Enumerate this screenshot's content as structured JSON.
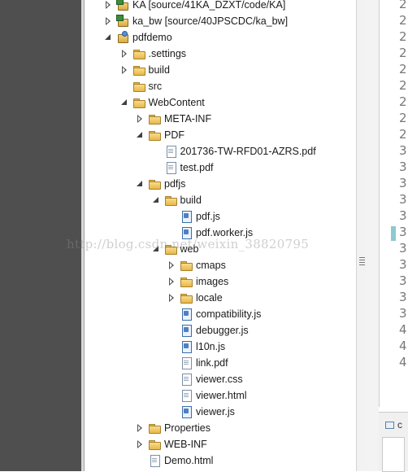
{
  "tree": [
    {
      "label": "KA [source/41KA_DZXT/code/KA]",
      "level": 1,
      "arrow": "collapsed",
      "icon": "projref"
    },
    {
      "label": "ka_bw [source/40JPSCDC/ka_bw]",
      "level": 1,
      "arrow": "collapsed",
      "icon": "projref"
    },
    {
      "label": "pdfdemo",
      "level": 1,
      "arrow": "expanded",
      "icon": "project"
    },
    {
      "label": ".settings",
      "level": 2,
      "arrow": "collapsed",
      "icon": "folder"
    },
    {
      "label": "build",
      "level": 2,
      "arrow": "collapsed",
      "icon": "folder"
    },
    {
      "label": "src",
      "level": 2,
      "arrow": "none",
      "icon": "folder"
    },
    {
      "label": "WebContent",
      "level": 2,
      "arrow": "expanded",
      "icon": "folder"
    },
    {
      "label": "META-INF",
      "level": 3,
      "arrow": "collapsed",
      "icon": "folder"
    },
    {
      "label": "PDF",
      "level": 3,
      "arrow": "expanded",
      "icon": "folder"
    },
    {
      "label": "201736-TW-RFD01-AZRS.pdf",
      "level": 4,
      "arrow": "none",
      "icon": "file"
    },
    {
      "label": "test.pdf",
      "level": 4,
      "arrow": "none",
      "icon": "file"
    },
    {
      "label": "pdfjs",
      "level": 3,
      "arrow": "expanded",
      "icon": "folder"
    },
    {
      "label": "build",
      "level": 4,
      "arrow": "expanded",
      "icon": "folder"
    },
    {
      "label": "pdf.js",
      "level": 5,
      "arrow": "none",
      "icon": "jsfile"
    },
    {
      "label": "pdf.worker.js",
      "level": 5,
      "arrow": "none",
      "icon": "jsfile"
    },
    {
      "label": "web",
      "level": 4,
      "arrow": "expanded",
      "icon": "folder"
    },
    {
      "label": "cmaps",
      "level": 5,
      "arrow": "collapsed",
      "icon": "folder"
    },
    {
      "label": "images",
      "level": 5,
      "arrow": "collapsed",
      "icon": "folder"
    },
    {
      "label": "locale",
      "level": 5,
      "arrow": "collapsed",
      "icon": "folder"
    },
    {
      "label": "compatibility.js",
      "level": 5,
      "arrow": "none",
      "icon": "jsfile"
    },
    {
      "label": "debugger.js",
      "level": 5,
      "arrow": "none",
      "icon": "jsfile"
    },
    {
      "label": "l10n.js",
      "level": 5,
      "arrow": "none",
      "icon": "jsfile"
    },
    {
      "label": "link.pdf",
      "level": 5,
      "arrow": "none",
      "icon": "file"
    },
    {
      "label": "viewer.css",
      "level": 5,
      "arrow": "none",
      "icon": "file"
    },
    {
      "label": "viewer.html",
      "level": 5,
      "arrow": "none",
      "icon": "file"
    },
    {
      "label": "viewer.js",
      "level": 5,
      "arrow": "none",
      "icon": "jsfile"
    },
    {
      "label": "Properties",
      "level": 3,
      "arrow": "collapsed",
      "icon": "folder"
    },
    {
      "label": "WEB-INF",
      "level": 3,
      "arrow": "collapsed",
      "icon": "folder"
    },
    {
      "label": "Demo.html",
      "level": 3,
      "arrow": "none",
      "icon": "file"
    }
  ],
  "watermark": "http://blog.csdn.net/weixin_38820795",
  "editor_line_numbers": [
    "2",
    "2",
    "2",
    "2",
    "2",
    "2",
    "2",
    "2",
    "2",
    "3",
    "3",
    "3",
    "3",
    "3",
    "3",
    "3",
    "3",
    "3",
    "3",
    "3",
    "4",
    "4",
    "4"
  ],
  "highlighted_line_index": 14,
  "bottom_tab_label": "c",
  "colors": {
    "sidebar_dark": "#4f4f4f",
    "marker": "#8ec9cf",
    "folder": "#e8b84a"
  }
}
